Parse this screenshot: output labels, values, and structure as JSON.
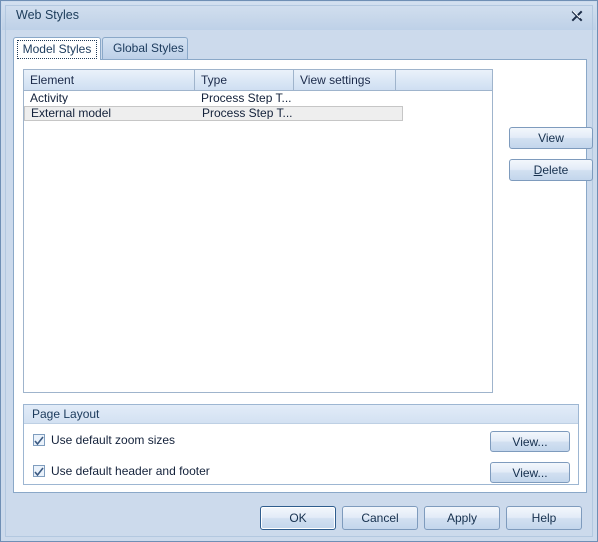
{
  "window": {
    "title": "Web Styles",
    "close_icon": "close-x-icon"
  },
  "tabs": [
    {
      "label": "Model Styles",
      "active": true
    },
    {
      "label": "Global Styles",
      "active": false
    }
  ],
  "styles_table": {
    "columns": [
      "Element",
      "Type",
      "View settings",
      ""
    ],
    "rows": [
      {
        "element": "Activity",
        "type": "Process Step T...",
        "view_settings": "",
        "selected": false
      },
      {
        "element": "External model",
        "type": "Process Step T...",
        "view_settings": "",
        "selected": true
      }
    ]
  },
  "side_buttons": {
    "view_label": "View",
    "delete_label_prefix": "D",
    "delete_label_rest": "elete"
  },
  "page_layout": {
    "title": "Page Layout",
    "checkboxes": [
      {
        "label": "Use default zoom sizes",
        "checked": true,
        "button_label": "View..."
      },
      {
        "label": "Use default header and footer",
        "checked": true,
        "button_label": "View..."
      }
    ]
  },
  "footer": {
    "ok_label": "OK",
    "cancel_label": "Cancel",
    "apply_label": "Apply",
    "help_label": "Help"
  },
  "colors": {
    "dialog_background": "#ccdaec",
    "dialog_border": "#6f8fb5",
    "panel_background": "#ffffff",
    "tab_active_background": "#ffffff",
    "tab_inactive_background": "#c9daee",
    "header_gradient_top": "#eaf1fa",
    "header_gradient_bottom": "#cfdff2",
    "selected_row_background": "#eeeeee",
    "text_color": "#13213a",
    "accent_border": "#8aa8c8"
  }
}
